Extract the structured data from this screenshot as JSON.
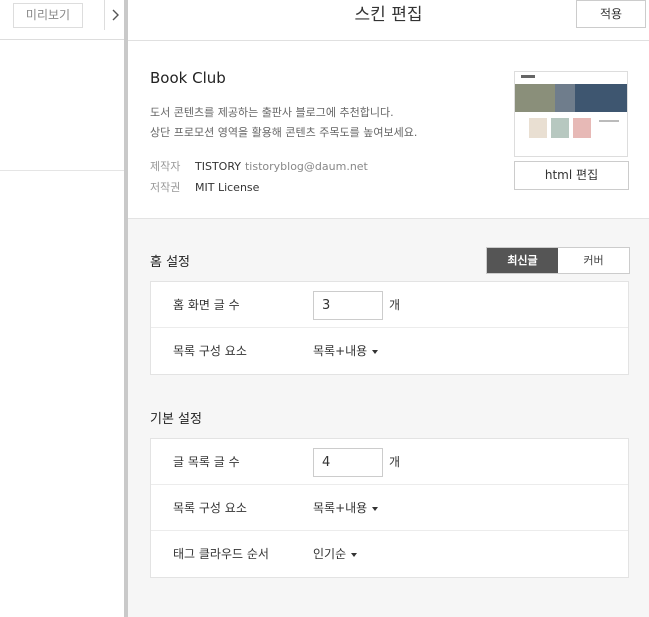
{
  "left": {
    "preview_label": "미리보기"
  },
  "header": {
    "title": "스킨 편집",
    "apply_label": "적용"
  },
  "skin": {
    "name": "Book Club",
    "description_line1": "도서 콘텐츠를 제공하는 출판사 블로그에 추천합니다.",
    "description_line2": "상단 프로모션 영역을 활용해 콘텐츠 주목도를 높여보세요.",
    "author_label": "제작자",
    "author_name": "TISTORY",
    "author_email": "tistoryblog@daum.net",
    "license_label": "저작권",
    "license_value": "MIT License",
    "html_edit_label": "html 편집"
  },
  "home_settings": {
    "title": "홈 설정",
    "toggle_on": "최신글",
    "toggle_off": "커버",
    "rows": [
      {
        "label": "홈 화면 글 수",
        "value": "3",
        "unit": "개"
      },
      {
        "label": "목록 구성 요소",
        "value": "목록+내용"
      }
    ]
  },
  "basic_settings": {
    "title": "기본 설정",
    "rows": [
      {
        "label": "글 목록 글 수",
        "value": "4",
        "unit": "개"
      },
      {
        "label": "목록 구성 요소",
        "value": "목록+내용"
      },
      {
        "label": "태그 클라우드 순서",
        "value": "인기순"
      }
    ]
  }
}
